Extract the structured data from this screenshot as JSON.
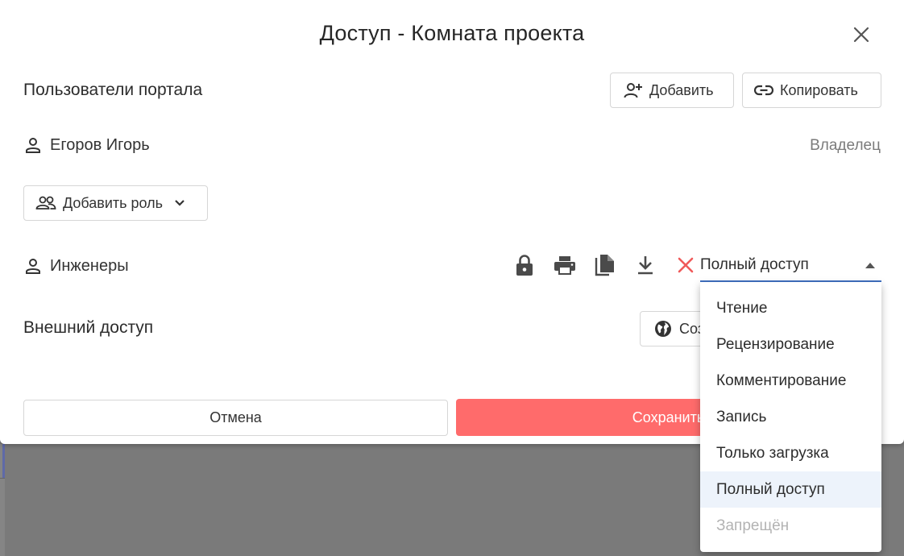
{
  "dialog": {
    "title": "Доступ - Комната проекта",
    "close_icon": "close-icon"
  },
  "portal_users": {
    "title": "Пользователи портала",
    "add_label": "Добавить",
    "copy_label": "Копировать",
    "owner_name": "Егоров Игорь",
    "owner_role": "Владелец",
    "add_role_label": "Добавить роль",
    "group_name": "Инженеры",
    "permission_icons": [
      "lock-icon",
      "print-icon",
      "copy-file-icon",
      "download-icon",
      "remove-icon"
    ],
    "selected_access": "Полный доступ"
  },
  "external_access": {
    "title": "Внешний доступ",
    "create_label_partial": "Соз"
  },
  "footer": {
    "cancel_label": "Отмена",
    "save_label_partial": "Сохранить"
  },
  "access_menu": {
    "options": [
      {
        "label": "Чтение",
        "state": "normal"
      },
      {
        "label": "Рецензирование",
        "state": "normal"
      },
      {
        "label": "Комментирование",
        "state": "normal"
      },
      {
        "label": "Запись",
        "state": "normal"
      },
      {
        "label": "Только загрузка",
        "state": "normal"
      },
      {
        "label": "Полный доступ",
        "state": "selected"
      },
      {
        "label": "Запрещён",
        "state": "disabled"
      }
    ]
  },
  "colors": {
    "accent_red": "#ff6b6b",
    "select_underline": "#3f6fbf",
    "remove_red": "#f05a5a",
    "selected_bg": "#edf3fb"
  }
}
